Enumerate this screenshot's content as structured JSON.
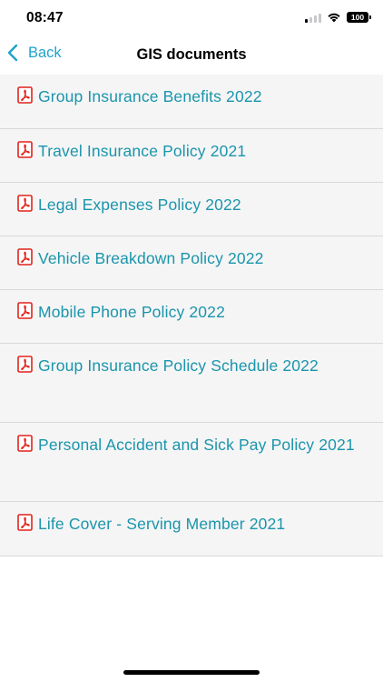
{
  "status_bar": {
    "time": "08:47",
    "battery": "100"
  },
  "nav": {
    "back_label": "Back",
    "title": "GIS documents"
  },
  "documents": [
    "Group Insurance Benefits 2022",
    "Travel Insurance Policy 2021",
    "Legal Expenses Policy 2022",
    "Vehicle Breakdown Policy 2022",
    "Mobile Phone Policy 2022",
    "Group Insurance Policy Schedule 2022",
    "Personal Accident and Sick Pay Policy 2021",
    "Life Cover - Serving Member 2021"
  ],
  "colors": {
    "accent": "#1fa3c9",
    "link_text": "#1a95ab",
    "pdf_icon": "#e2231a",
    "list_background": "#f5f5f6"
  },
  "icons": {
    "document": "pdf-icon",
    "back": "chevron-left-icon"
  }
}
